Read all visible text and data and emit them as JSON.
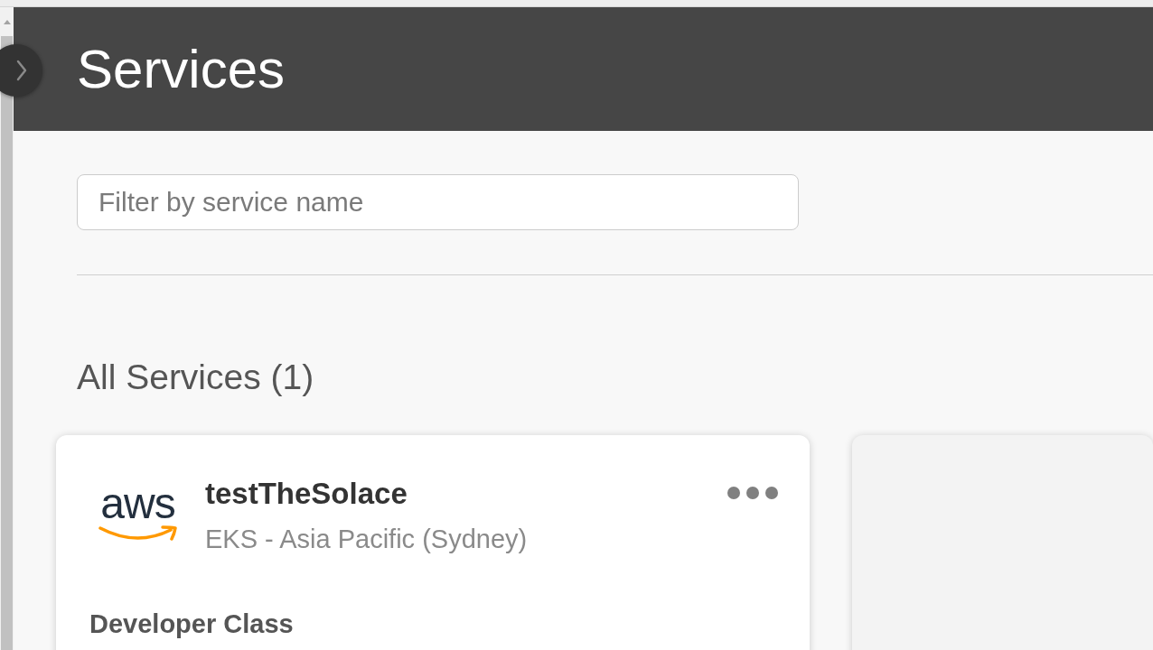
{
  "header": {
    "title": "Services"
  },
  "filter": {
    "placeholder": "Filter by service name"
  },
  "section": {
    "title": "All Services (1)"
  },
  "services": [
    {
      "kind": "service",
      "name": "testTheSolace",
      "logo_text": "aws",
      "location": "EKS - Asia Pacific (Sydney)",
      "service_class": "Developer Class"
    },
    {
      "kind": "empty"
    }
  ]
}
